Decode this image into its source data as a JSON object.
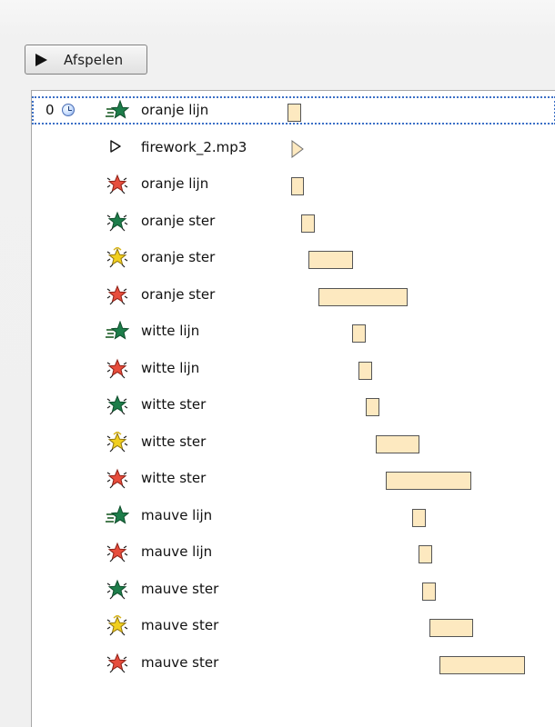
{
  "toolbar": {
    "play_label": "Afspelen"
  },
  "list": {
    "rows": [
      {
        "type": "effect",
        "label": "oranje lijn",
        "icon": "wipe-star-icon",
        "order": "0",
        "show_trigger": true
      },
      {
        "type": "audio",
        "label": "firework_2.mp3",
        "icon": "audio-play-icon"
      },
      {
        "type": "effect",
        "label": "oranje lijn",
        "icon": "burst-star-red-icon"
      },
      {
        "type": "effect",
        "label": "oranje ster",
        "icon": "burst-star-green-icon"
      },
      {
        "type": "effect",
        "label": "oranje ster",
        "icon": "burst-star-yellow-icon"
      },
      {
        "type": "effect",
        "label": "oranje ster",
        "icon": "burst-star-red-icon"
      },
      {
        "type": "effect",
        "label": "witte lijn",
        "icon": "wipe-star-icon"
      },
      {
        "type": "effect",
        "label": "witte lijn",
        "icon": "burst-star-red-icon"
      },
      {
        "type": "effect",
        "label": "witte ster",
        "icon": "burst-star-green-icon"
      },
      {
        "type": "effect",
        "label": "witte ster",
        "icon": "burst-star-yellow-icon"
      },
      {
        "type": "effect",
        "label": "witte ster",
        "icon": "burst-star-red-icon"
      },
      {
        "type": "effect",
        "label": "mauve lijn",
        "icon": "wipe-star-icon"
      },
      {
        "type": "effect",
        "label": "mauve lijn",
        "icon": "burst-star-red-icon"
      },
      {
        "type": "effect",
        "label": "mauve ster",
        "icon": "burst-star-green-icon"
      },
      {
        "type": "effect",
        "label": "mauve ster",
        "icon": "burst-star-yellow-icon"
      },
      {
        "type": "effect",
        "label": "mauve ster",
        "icon": "burst-star-red-icon"
      }
    ]
  },
  "colors": {
    "bar_fill": "#fde9c0",
    "bar_border": "#555555",
    "selection": "#3b6fc6",
    "star_red": "#e74d3c",
    "star_green": "#1d7d4a",
    "star_yellow": "#f1cf1f"
  }
}
